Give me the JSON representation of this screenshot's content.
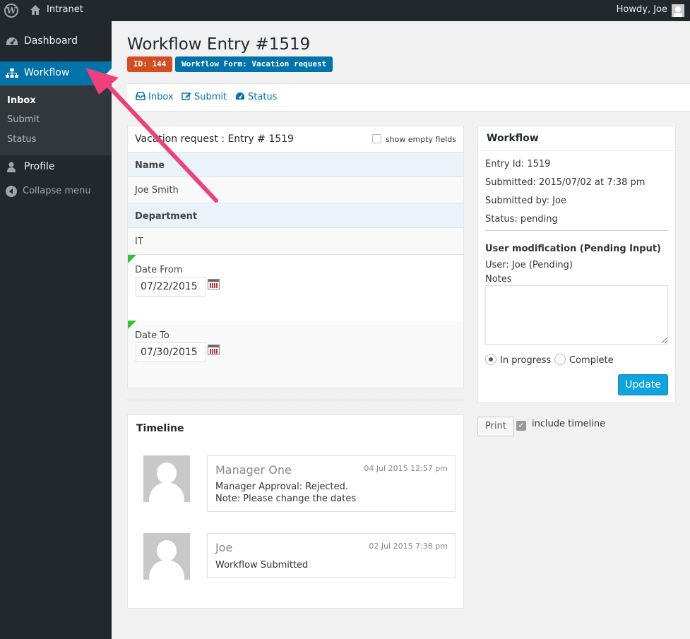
{
  "adminbar": {
    "site_name": "Intranet",
    "howdy": "Howdy, Joe"
  },
  "sidebar": {
    "items": [
      {
        "label": "Dashboard",
        "icon": "dashboard-icon"
      },
      {
        "label": "Workflow",
        "icon": "sitemap-icon"
      },
      {
        "label": "Profile",
        "icon": "user-icon"
      },
      {
        "label": "Collapse menu",
        "icon": "collapse-icon"
      }
    ],
    "submenu": [
      "Inbox",
      "Submit",
      "Status"
    ]
  },
  "header": {
    "title": "Workflow Entry #1519",
    "id_pill": "ID: 144",
    "form_pill": "Workflow Form: Vacation request"
  },
  "toolbar": {
    "inbox": "Inbox",
    "submit": "Submit",
    "status": "Status"
  },
  "entry": {
    "title": "Vacation request : Entry # 1519",
    "show_empty": "show empty fields",
    "fields": [
      {
        "label": "Name",
        "value": "Joe Smith"
      },
      {
        "label": "Department",
        "value": "IT"
      }
    ],
    "date_from_label": "Date From",
    "date_from_value": "07/22/2015",
    "date_to_label": "Date To",
    "date_to_value": "07/30/2015"
  },
  "workflow": {
    "title": "Workflow",
    "entry_id": "Entry Id: 1519",
    "submitted": "Submitted: 2015/07/02 at 7:38 pm",
    "submitted_by": "Submitted by: Joe",
    "status": "Status: pending",
    "step_title": "User modification (Pending Input)",
    "step_user": "User: Joe (Pending)",
    "notes_label": "Notes",
    "radio_in_progress": "In progress",
    "radio_complete": "Complete",
    "update": "Update"
  },
  "print": {
    "button": "Print",
    "include_timeline": "include timeline"
  },
  "timeline": {
    "title": "Timeline",
    "entries": [
      {
        "name": "Manager One",
        "date": "04 Jul 2015 12:57 pm",
        "line1": "Manager Approval: Rejected.",
        "line2": "Note: Please change the dates"
      },
      {
        "name": "Joe",
        "date": "02 Jul 2015 7:38 pm",
        "line1": "Workflow Submitted"
      }
    ]
  },
  "colors": {
    "accent": "#0073aa",
    "sidebar_bg": "#23282d",
    "id_pill": "#d54e21",
    "arrow": "#f0407a",
    "update_button": "#0ea4df"
  }
}
